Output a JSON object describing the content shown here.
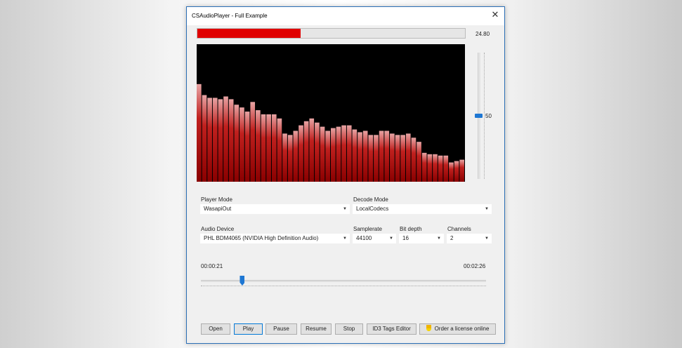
{
  "window": {
    "title": "CSAudioPlayer - Full Example"
  },
  "progress": {
    "fraction": 0.385,
    "level_text": "24.80"
  },
  "spectrum": {
    "bar_color": "#c0201e",
    "top_color": "#e8a4a4",
    "bars": [
      0.71,
      0.63,
      0.61,
      0.61,
      0.6,
      0.62,
      0.6,
      0.56,
      0.54,
      0.51,
      0.58,
      0.52,
      0.49,
      0.49,
      0.49,
      0.46,
      0.35,
      0.34,
      0.37,
      0.41,
      0.44,
      0.46,
      0.43,
      0.4,
      0.37,
      0.39,
      0.4,
      0.41,
      0.41,
      0.38,
      0.36,
      0.37,
      0.34,
      0.34,
      0.37,
      0.37,
      0.35,
      0.34,
      0.34,
      0.35,
      0.32,
      0.29,
      0.21,
      0.2,
      0.2,
      0.19,
      0.19,
      0.14,
      0.15,
      0.16
    ]
  },
  "volume": {
    "value": "50",
    "fraction": 0.5
  },
  "player_mode": {
    "label": "Player Mode",
    "value": "WasapiOut"
  },
  "decode_mode": {
    "label": "Decode Mode",
    "value": "LocalCodecs"
  },
  "audio_device": {
    "label": "Audio Device",
    "value": "PHL BDM4065 (NVIDIA High Definition Audio)"
  },
  "samplerate": {
    "label": "Samplerate",
    "value": "44100"
  },
  "bit_depth": {
    "label": "Bit depth",
    "value": "16"
  },
  "channels": {
    "label": "Channels",
    "value": "2"
  },
  "position": {
    "elapsed": "00:00:21",
    "total": "00:02:26",
    "fraction": 0.144
  },
  "buttons": {
    "open": "Open",
    "play": "Play",
    "pause": "Pause",
    "resume": "Resume",
    "stop": "Stop",
    "id3": "ID3 Tags Editor",
    "license": "Order a license online"
  },
  "icons": {
    "close": "close-icon",
    "dropdown": "chevron-down-icon",
    "license": "medal-icon"
  }
}
